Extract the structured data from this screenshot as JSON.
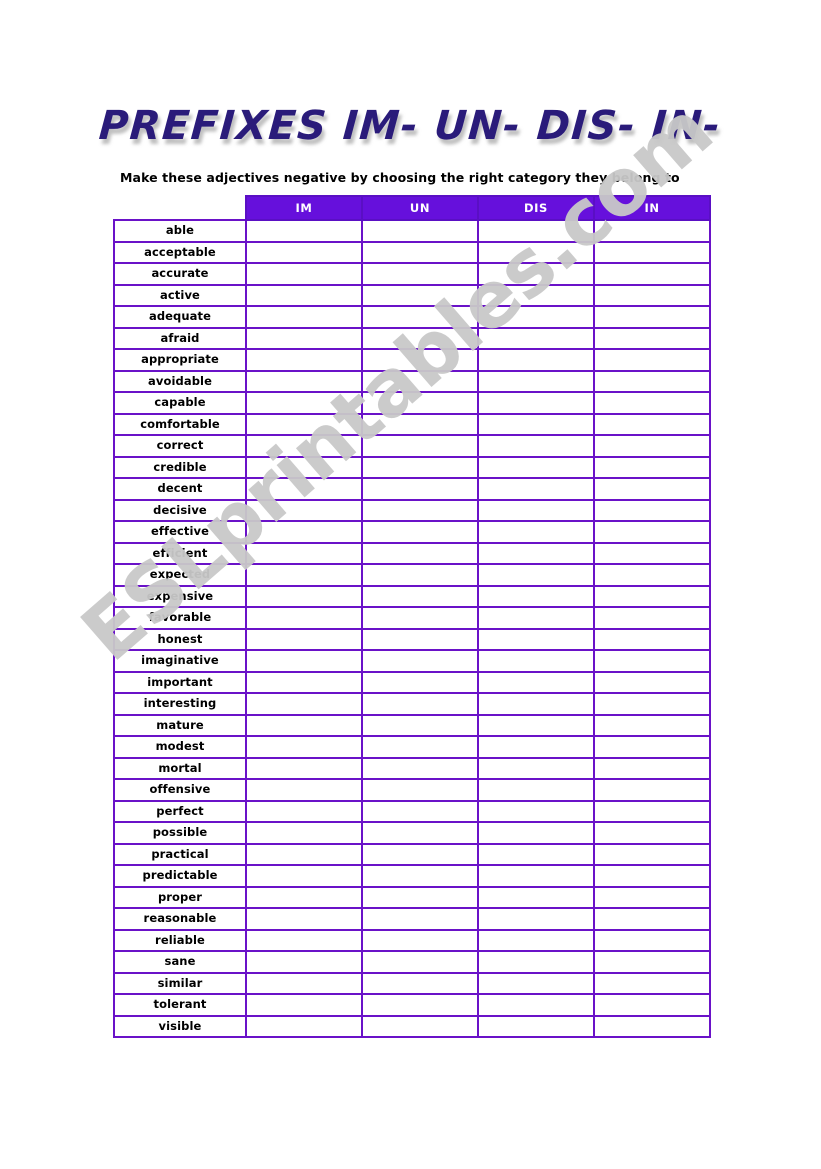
{
  "page": {
    "title": "PREFIXES IM- UN- DIS- IN-",
    "instruction": "Make these adjectives negative by choosing the right category they belong to",
    "watermark": "ESLprintables.com"
  },
  "colors": {
    "title_text": "#2a1b7a",
    "header_fill": "#6610dc",
    "header_text": "#ffffff",
    "table_border": "#6a12c8",
    "body_text": "#000000",
    "watermark": "#c9c9c9",
    "page_background": "#ffffff"
  },
  "table": {
    "corner_label": "",
    "columns": [
      "IM",
      "UN",
      "DIS",
      "IN"
    ],
    "rows": [
      "able",
      "acceptable",
      "accurate",
      "active",
      "adequate",
      "afraid",
      "appropriate",
      "avoidable",
      "capable",
      "comfortable",
      "correct",
      "credible",
      "decent",
      "decisive",
      "effective",
      "efficient",
      "expected",
      "expensive",
      "favorable",
      "honest",
      "imaginative",
      "important",
      "interesting",
      "mature",
      "modest",
      "mortal",
      "offensive",
      "perfect",
      "possible",
      "practical",
      "predictable",
      "proper",
      "reasonable",
      "reliable",
      "sane",
      "similar",
      "tolerant",
      "visible"
    ],
    "row_count": 38,
    "answers": []
  }
}
